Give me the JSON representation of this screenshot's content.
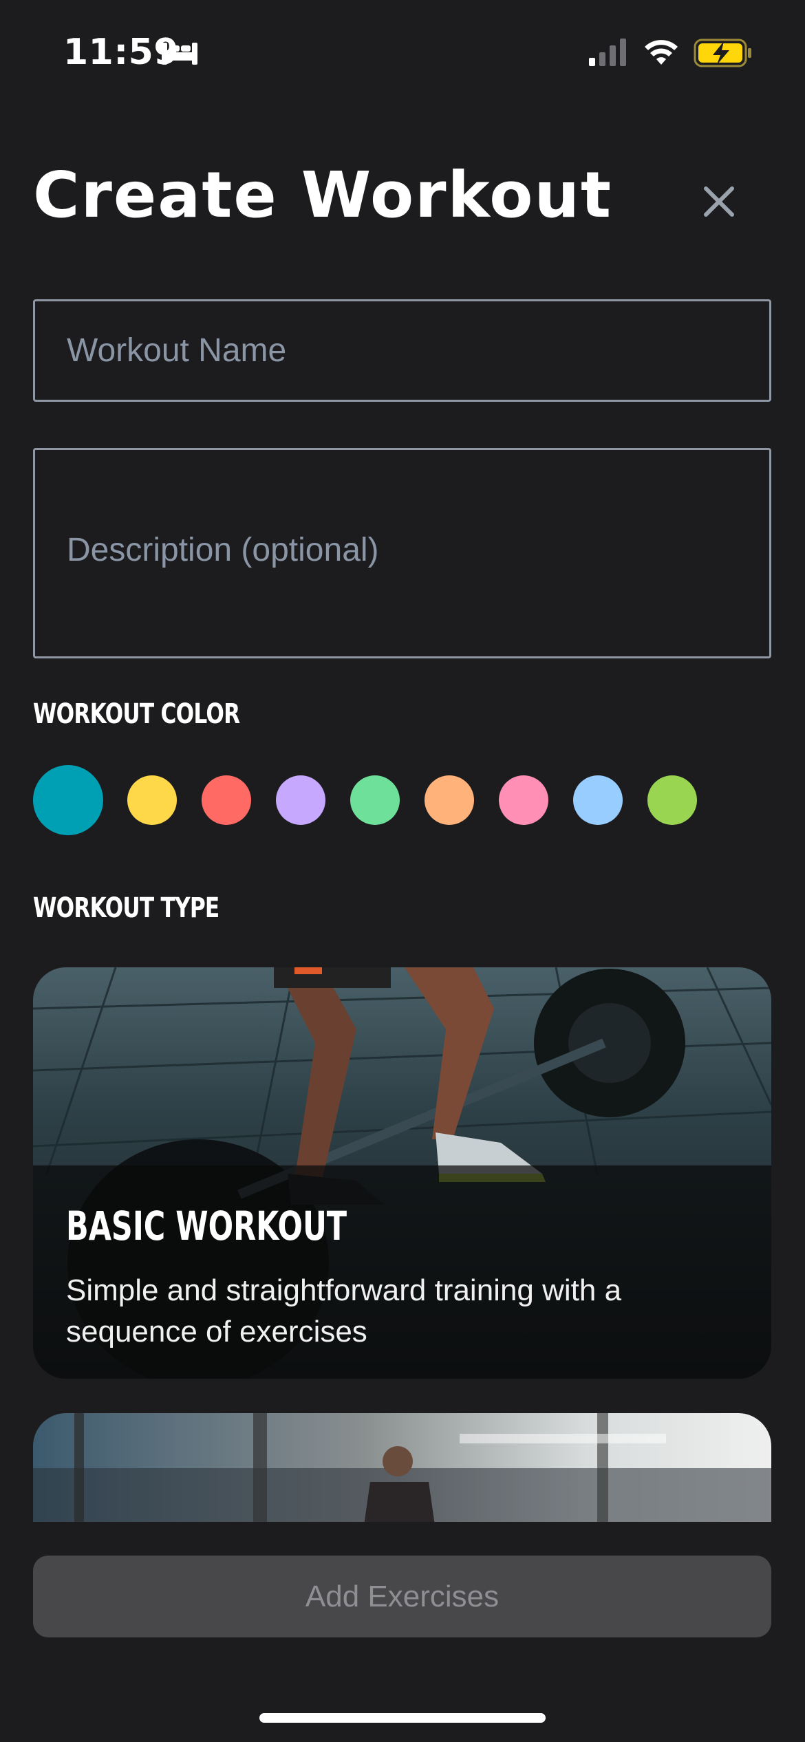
{
  "status_bar": {
    "time": "11:59",
    "icons": [
      "bed-icon",
      "cellular-signal-icon",
      "wifi-icon",
      "battery-charging-icon"
    ],
    "battery_color": "#ffd60a"
  },
  "header": {
    "title": "Create Workout",
    "close_icon": "close-icon"
  },
  "form": {
    "name_placeholder": "Workout Name",
    "name_value": "",
    "description_placeholder": "Description (optional)",
    "description_value": ""
  },
  "color_section": {
    "label": "WORKOUT COLOR",
    "colors": [
      "#00a0b4",
      "#ffd84a",
      "#ff6b64",
      "#c6a8ff",
      "#6fe09a",
      "#ffb27a",
      "#ff8fb5",
      "#98cdff",
      "#9ad552"
    ],
    "selected_index": 0
  },
  "type_section": {
    "label": "WORKOUT TYPE",
    "cards": [
      {
        "title": "BASIC WORKOUT",
        "description": "Simple and straightforward training with a sequence of exercises",
        "image": "deadlift-photo"
      },
      {
        "title": "",
        "description": "",
        "image": "gym-photo"
      }
    ]
  },
  "footer": {
    "button_label": "Add Exercises",
    "button_enabled": false
  }
}
